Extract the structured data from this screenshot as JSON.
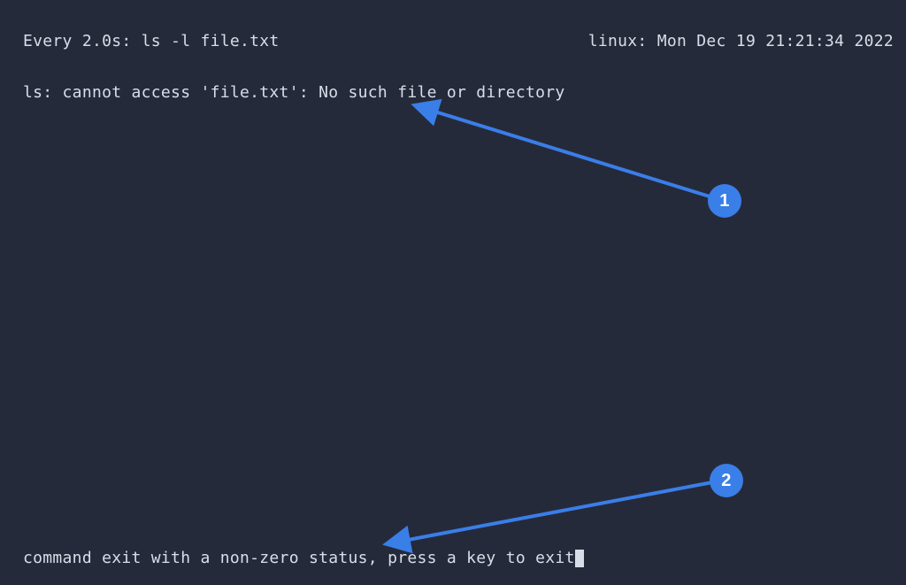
{
  "watch": {
    "interval_label": "Every 2.0s: ls -l file.txt",
    "host_time": "linux: Mon Dec 19 21:21:34 2022"
  },
  "output": {
    "error_line": "ls: cannot access 'file.txt': No such file or directory"
  },
  "status": {
    "exit_message": "command exit with a non-zero status, press a key to exit"
  },
  "annotations": {
    "one": "1",
    "two": "2"
  },
  "colors": {
    "bg": "#252a3a",
    "fg": "#d8dee9",
    "accent": "#3a7ee8"
  }
}
